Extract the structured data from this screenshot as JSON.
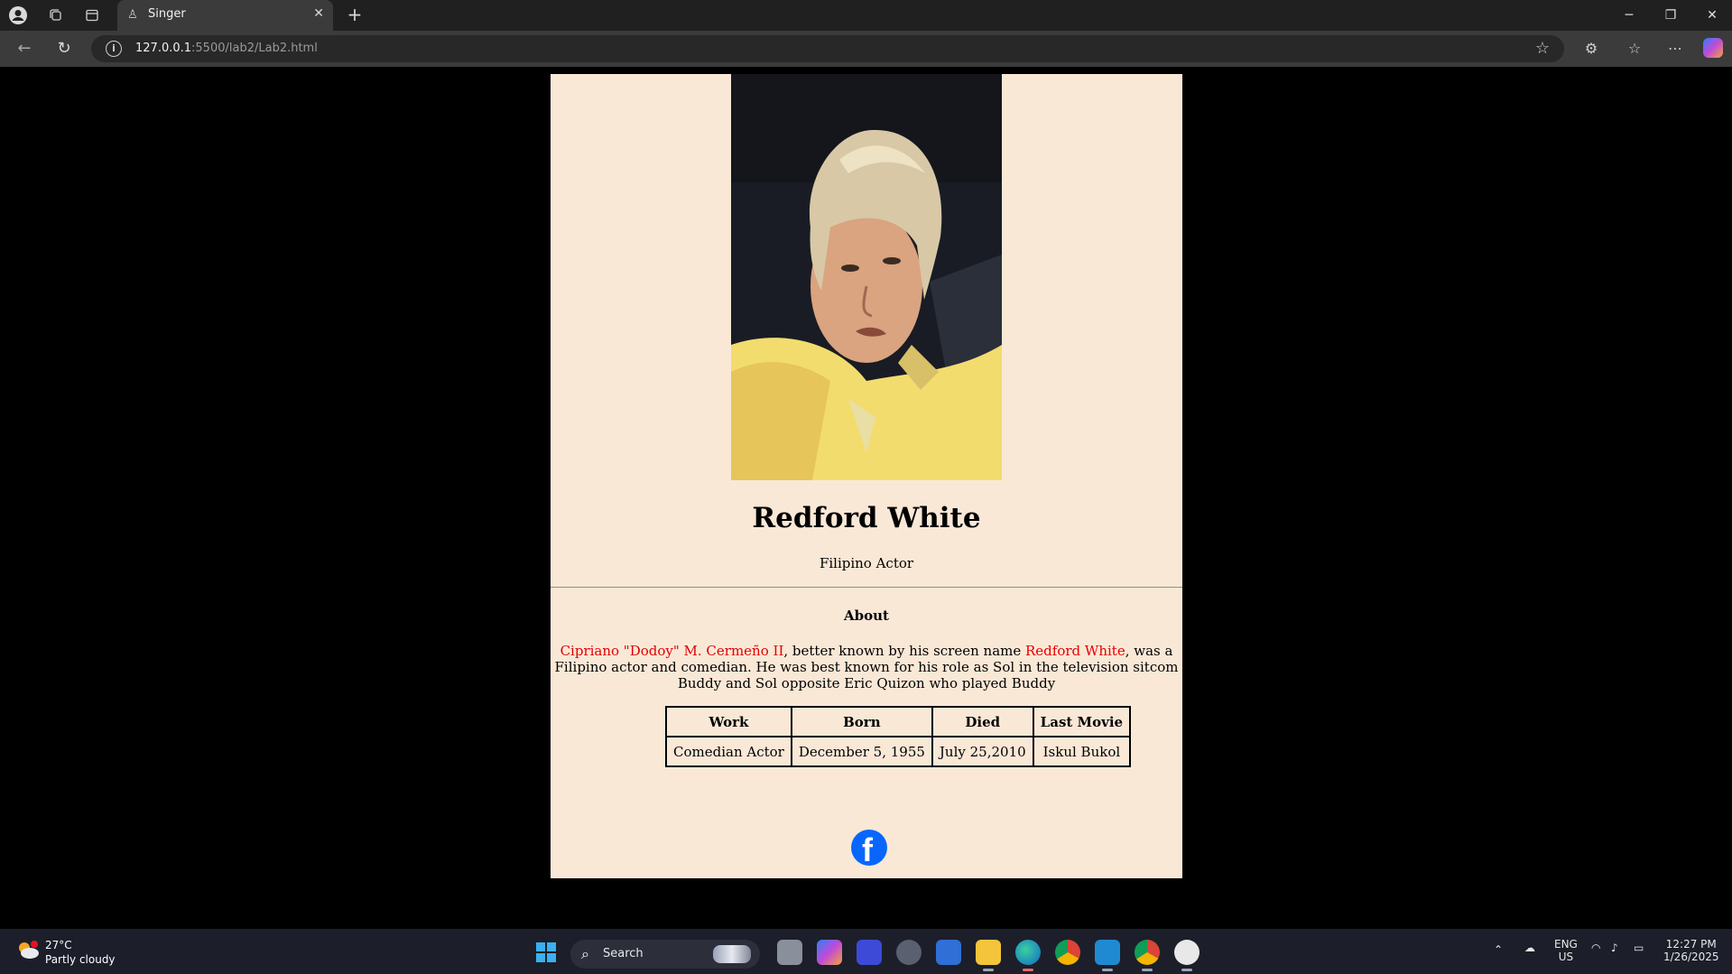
{
  "browser": {
    "tab_title": "Singer",
    "url_host": "127.0.0.1",
    "url_path": ":5500/lab2/Lab2.html"
  },
  "page": {
    "name": "Redford White",
    "subtitle": "Filipino Actor",
    "about_heading": "About",
    "bio": {
      "full_name": "Cipriano \"Dodoy\" M. Cermeño II",
      "part1": ", better known by his screen name ",
      "screen_name": "Redford White",
      "part2": ", was a Filipino actor and comedian. He was best known for his role as Sol in the television sitcom Buddy and Sol opposite Eric Quizon who played Buddy"
    },
    "table": {
      "headers": [
        "Work",
        "Born",
        "Died",
        "Last Movie"
      ],
      "row": [
        "Comedian Actor",
        "December 5, 1955",
        "July 25,2010",
        "Iskul Bukol"
      ]
    },
    "accent_color": "#e20000",
    "background_color": "#fae8d7"
  },
  "taskbar": {
    "temperature": "27°C",
    "weather": "Partly cloudy",
    "search_label": "Search",
    "language_1": "ENG",
    "language_2": "US",
    "time": "12:27 PM",
    "date": "1/26/2025"
  }
}
